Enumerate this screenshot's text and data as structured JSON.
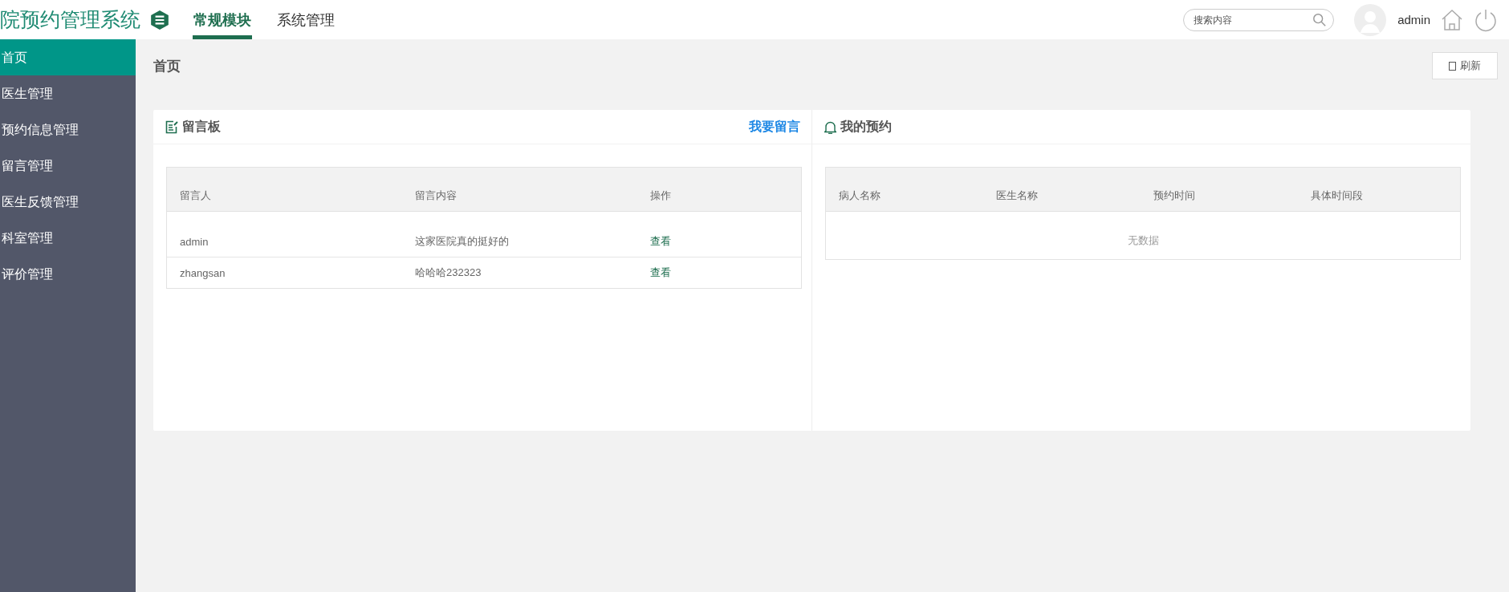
{
  "header": {
    "title": "院预约管理系统",
    "tabs": [
      {
        "label": "常规模块",
        "selected": true
      },
      {
        "label": "系统管理",
        "selected": false
      }
    ],
    "search": {
      "placeholder": "搜索内容"
    },
    "user": "admin"
  },
  "sidebar": {
    "items": [
      {
        "label": "首页",
        "selected": true
      },
      {
        "label": "医生管理",
        "selected": false
      },
      {
        "label": "预约信息管理",
        "selected": false
      },
      {
        "label": "留言管理",
        "selected": false
      },
      {
        "label": "医生反馈管理",
        "selected": false
      },
      {
        "label": "科室管理",
        "selected": false
      },
      {
        "label": "评价管理",
        "selected": false
      }
    ]
  },
  "breadcrumb": "首页",
  "refresh_button": "刷新",
  "message_board": {
    "title": "留言板",
    "action": "我要留言",
    "columns": [
      "留言人",
      "留言内容",
      "操作"
    ],
    "rows": [
      {
        "author": "admin",
        "content": "这家医院真的挺好的",
        "link": "查看"
      },
      {
        "author": "zhangsan",
        "content": "哈哈哈232323",
        "link": "查看"
      }
    ]
  },
  "appointments": {
    "title": "我的预约",
    "columns": [
      "病人名称",
      "医生名称",
      "预约时间",
      "具体时间段"
    ],
    "empty": "无数据"
  }
}
